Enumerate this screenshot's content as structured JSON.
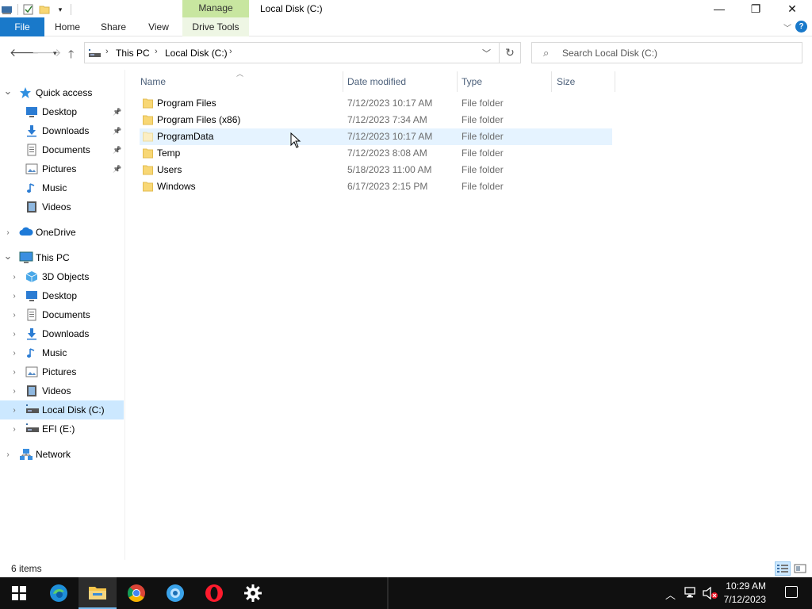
{
  "titlebar": {
    "context_tab": "Manage",
    "window_title": "Local Disk (C:)",
    "minimize_glyph": "—",
    "restore_glyph": "❐",
    "close_glyph": "✕"
  },
  "ribbon": {
    "tabs": [
      {
        "label": "File"
      },
      {
        "label": "Home"
      },
      {
        "label": "Share"
      },
      {
        "label": "View"
      },
      {
        "label": "Drive Tools"
      }
    ],
    "help_glyph": "?"
  },
  "address": {
    "crumbs": [
      "This PC",
      "Local Disk (C:)"
    ],
    "search_placeholder": "Search Local Disk (C:)"
  },
  "nav": {
    "items": [
      {
        "label": "Quick access",
        "icon": "star-icon",
        "pinned": false
      },
      {
        "label": "Desktop",
        "icon": "desktop-icon",
        "pinned": true
      },
      {
        "label": "Downloads",
        "icon": "download-icon",
        "pinned": true
      },
      {
        "label": "Documents",
        "icon": "documents-icon",
        "pinned": true
      },
      {
        "label": "Pictures",
        "icon": "pictures-icon",
        "pinned": true
      },
      {
        "label": "Music",
        "icon": "music-icon",
        "pinned": false
      },
      {
        "label": "Videos",
        "icon": "videos-icon",
        "pinned": false
      },
      {
        "label": "OneDrive",
        "icon": "cloud-icon",
        "pinned": false
      },
      {
        "label": "This PC",
        "icon": "computer-icon",
        "pinned": false
      },
      {
        "label": "3D Objects",
        "icon": "cube-icon",
        "pinned": false
      },
      {
        "label": "Desktop",
        "icon": "desktop-icon",
        "pinned": false
      },
      {
        "label": "Documents",
        "icon": "documents-icon",
        "pinned": false
      },
      {
        "label": "Downloads",
        "icon": "download-icon",
        "pinned": false
      },
      {
        "label": "Music",
        "icon": "music-icon",
        "pinned": false
      },
      {
        "label": "Pictures",
        "icon": "pictures-icon",
        "pinned": false
      },
      {
        "label": "Videos",
        "icon": "videos-icon",
        "pinned": false
      },
      {
        "label": "Local Disk (C:)",
        "icon": "drive-icon",
        "pinned": false,
        "selected": true
      },
      {
        "label": "EFI (E:)",
        "icon": "drive-icon",
        "pinned": false
      },
      {
        "label": "Network",
        "icon": "network-icon",
        "pinned": false
      }
    ]
  },
  "columns": {
    "name": "Name",
    "date": "Date modified",
    "type": "Type",
    "size": "Size"
  },
  "files": [
    {
      "name": "Program Files",
      "date": "7/12/2023 10:17 AM",
      "type": "File folder"
    },
    {
      "name": "Program Files (x86)",
      "date": "7/12/2023 7:34 AM",
      "type": "File folder"
    },
    {
      "name": "ProgramData",
      "date": "7/12/2023 10:17 AM",
      "type": "File folder",
      "hovered": true,
      "hidden_style": true
    },
    {
      "name": "Temp",
      "date": "7/12/2023 8:08 AM",
      "type": "File folder"
    },
    {
      "name": "Users",
      "date": "5/18/2023 11:00 AM",
      "type": "File folder"
    },
    {
      "name": "Windows",
      "date": "6/17/2023 2:15 PM",
      "type": "File folder"
    }
  ],
  "status": {
    "item_count": "6 items"
  },
  "taskbar": {
    "apps": [
      "start-icon",
      "edge-icon",
      "file-explorer-icon",
      "chrome-icon",
      "app-icon",
      "opera-icon",
      "settings-icon"
    ],
    "time": "10:29 AM",
    "date": "7/12/2023"
  },
  "colors": {
    "file_tab": "#1979ca",
    "manage_tab": "#c8e6a0",
    "selection": "#cce8ff",
    "hover": "#e5f3ff",
    "folder": "#f8d775"
  }
}
